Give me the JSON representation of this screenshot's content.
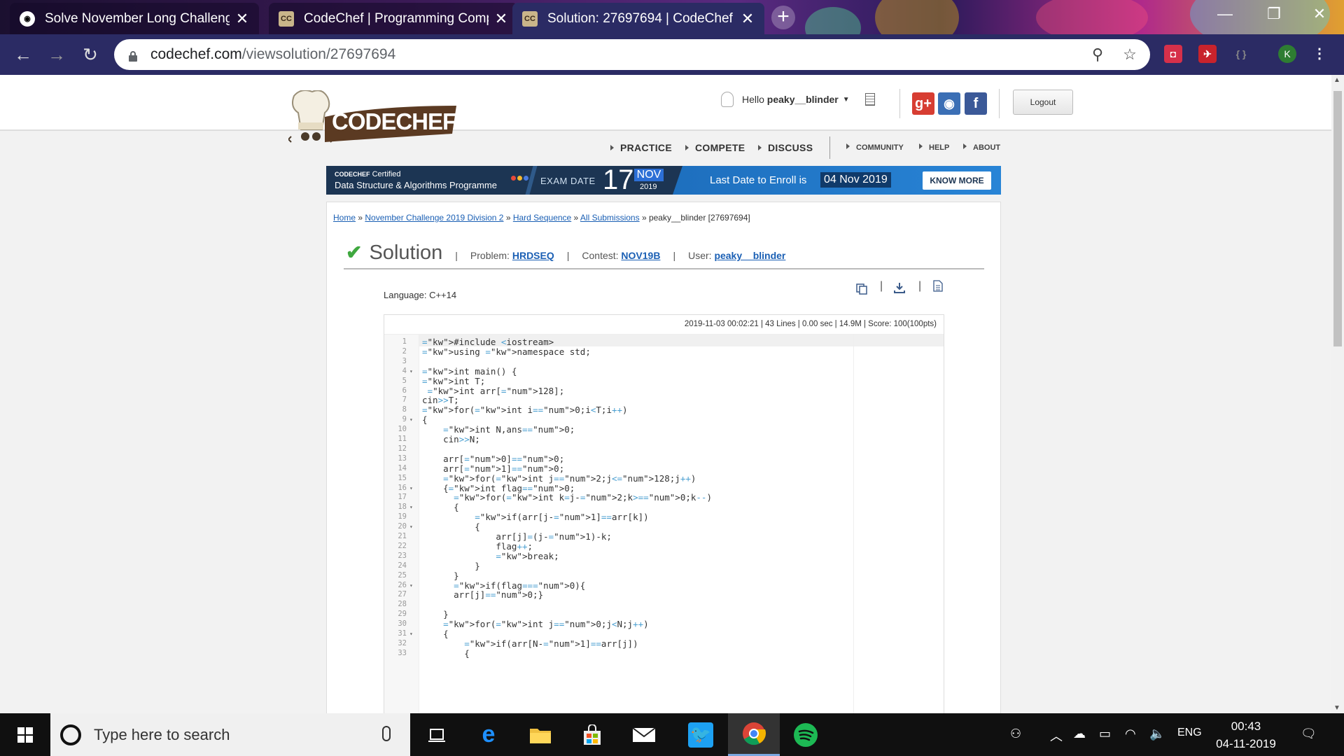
{
  "browser": {
    "tabs": [
      {
        "title": "Solve November Long Challenge",
        "icon": "github-icon",
        "active": false
      },
      {
        "title": "CodeChef | Programming Comp",
        "icon": "codechef-favicon-icon",
        "active": false
      },
      {
        "title": "Solution: 27697694 | CodeChef",
        "icon": "codechef-favicon-icon",
        "active": true
      }
    ],
    "url_host": "codechef.com",
    "url_path": "/viewsolution/27697694",
    "profile_initial": "K"
  },
  "header": {
    "logo_text": "CODECHEF",
    "greeting": "Hello",
    "username": "peaky__blinder",
    "logout_label": "Logout",
    "main_nav": [
      "PRACTICE",
      "COMPETE",
      "DISCUSS"
    ],
    "sub_nav": [
      "COMMUNITY",
      "HELP",
      "ABOUT"
    ]
  },
  "banner": {
    "brand": "CODECHEF",
    "certified": "Certified",
    "program": "Data Structure & Algorithms Programme",
    "exam_label": "EXAM DATE",
    "exam_day": "17",
    "exam_month": "NOV",
    "exam_year": "2019",
    "enroll_text": "Last Date to Enroll is",
    "enroll_date": "04 Nov 2019",
    "cta": "KNOW MORE"
  },
  "breadcrumb": {
    "items": [
      "Home",
      "November Challenge 2019 Division 2",
      "Hard Sequence",
      "All Submissions"
    ],
    "current": "peaky__blinder [27697694]"
  },
  "solution": {
    "title": "Solution",
    "problem_label": "Problem:",
    "problem": "HRDSEQ",
    "contest_label": "Contest:",
    "contest": "NOV19B",
    "user_label": "User:",
    "user": "peaky__blinder",
    "language": "Language: C++14",
    "stats": "2019-11-03 00:02:21  |  43 Lines  |  0.00 sec  |  14.9M  |  Score: 100(100pts)"
  },
  "code_lines": [
    "#include <iostream>",
    "using namespace std;",
    "",
    "int main() {",
    "int T;",
    " int arr[128];",
    "cin>>T;",
    "for(int i=0;i<T;i++)",
    "{",
    "    int N,ans=0;",
    "    cin>>N;",
    "",
    "    arr[0]=0;",
    "    arr[1]=0;",
    "    for(int j=2;j<128;j++)",
    "    {int flag=0;",
    "      for(int k=j-2;k>=0;k--)",
    "      {",
    "          if(arr[j-1]==arr[k])",
    "          {",
    "              arr[j]=(j-1)-k;",
    "              flag++;",
    "              break;",
    "          }",
    "      }",
    "      if(flag==0){",
    "      arr[j]=0;}",
    "",
    "    }",
    "    for(int j=0;j<N;j++)",
    "    {",
    "        if(arr[N-1]==arr[j])",
    "        {"
  ],
  "fold_lines": [
    4,
    9,
    16,
    18,
    20,
    26,
    31
  ],
  "taskbar": {
    "search_placeholder": "Type here to search",
    "time": "00:43",
    "date": "04-11-2019",
    "lang": "ENG"
  }
}
